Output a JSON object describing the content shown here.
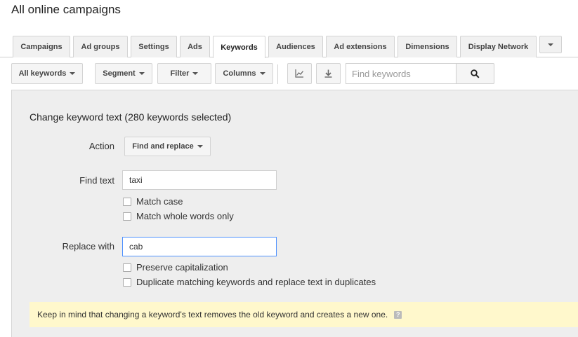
{
  "page": {
    "title": "All online campaigns"
  },
  "tabs": [
    {
      "label": "Campaigns"
    },
    {
      "label": "Ad groups"
    },
    {
      "label": "Settings"
    },
    {
      "label": "Ads"
    },
    {
      "label": "Keywords"
    },
    {
      "label": "Audiences"
    },
    {
      "label": "Ad extensions"
    },
    {
      "label": "Dimensions"
    },
    {
      "label": "Display Network"
    }
  ],
  "tabs_active": "Keywords",
  "toolbar": {
    "all_keywords": "All keywords",
    "segment": "Segment",
    "filter": "Filter",
    "columns": "Columns",
    "chart_icon": "line-chart-icon",
    "download_icon": "download-icon",
    "search_placeholder": "Find keywords",
    "search_icon": "search-icon"
  },
  "panel": {
    "title": "Change keyword text (280 keywords selected)",
    "action_label": "Action",
    "action_value": "Find and replace",
    "find_label": "Find text",
    "find_value": "taxi",
    "match_case": "Match case",
    "match_whole_words": "Match whole words only",
    "replace_label": "Replace with",
    "replace_value": "cab",
    "preserve_capitalization": "Preserve capitalization",
    "duplicate_keywords": "Duplicate matching keywords and replace text in duplicates",
    "notice": "Keep in mind that changing a keyword's text removes the old keyword and creates a new one.",
    "help_icon": "?"
  },
  "colors": {
    "notice_bg": "#fff8cc",
    "focus_border": "#4d90fe",
    "panel_bg": "#eeeeee"
  }
}
